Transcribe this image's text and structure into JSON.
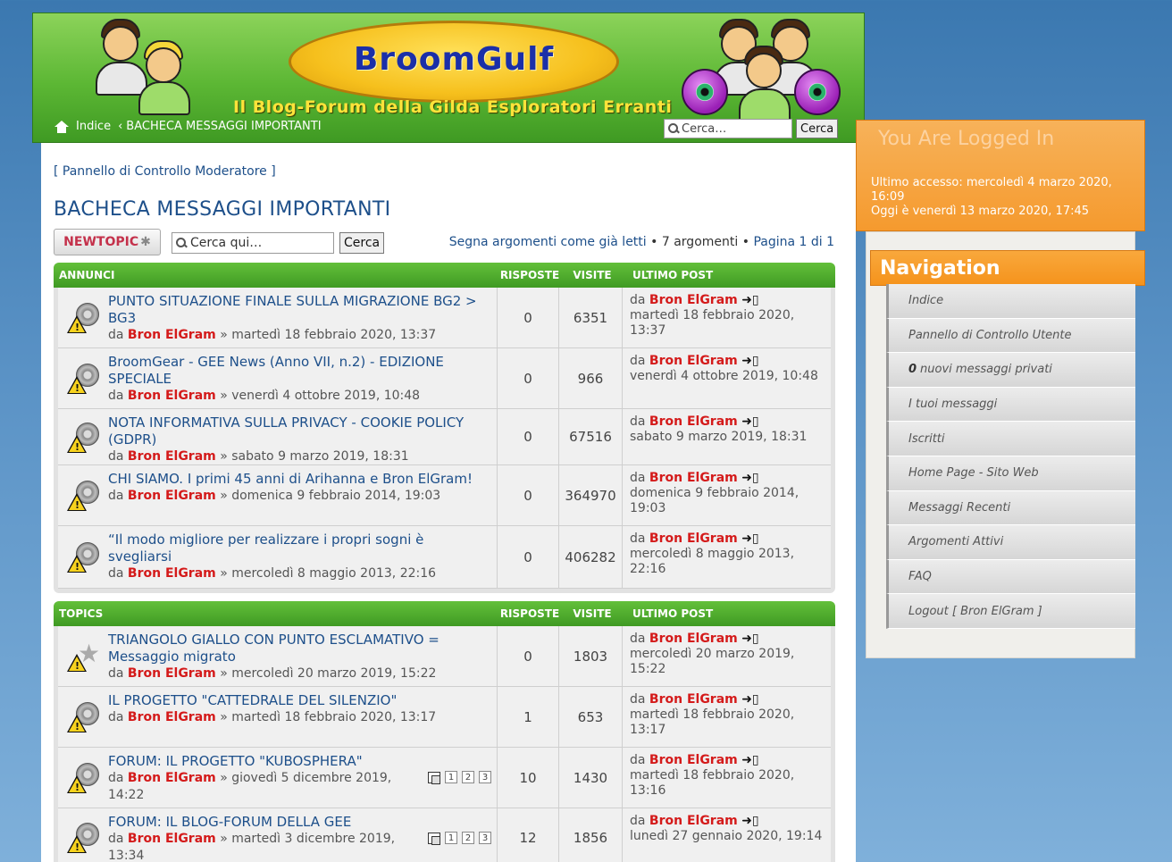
{
  "header": {
    "logo": "BroomGulf",
    "tagline": "Il Blog-Forum della Gilda Esploratori Erranti",
    "breadcrumb_home": "Indice",
    "breadcrumb_sep": "‹",
    "breadcrumb_current": "BACHECA MESSAGGI IMPORTANTI",
    "search_placeholder": "Cerca…",
    "search_button": "Cerca"
  },
  "main": {
    "mcp_link": "[ Pannello di Controllo Moderatore ]",
    "title": "BACHECA MESSAGGI IMPORTANTI",
    "newtopic_label": "NEWTOPIC",
    "search_placeholder": "Cerca qui…",
    "search_button": "Cerca",
    "mark_read": "Segna argomenti come già letti",
    "topic_count": "7 argomenti",
    "pagination": "Pagina 1 di 1"
  },
  "announcements": {
    "header": {
      "title": "ANNUNCI",
      "replies": "RISPOSTE",
      "views": "VISITE",
      "last": "ULTIMO POST"
    },
    "rows": [
      {
        "title": "PUNTO SITUAZIONE FINALE SULLA MIGRAZIONE BG2 > BG3",
        "by": "da",
        "author": "Bron ElGram",
        "date": "» martedì 18 febbraio 2020, 13:37",
        "replies": "0",
        "views": "6351",
        "last_by": "da",
        "last_author": "Bron ElGram",
        "last_date": "martedì 18 febbraio 2020, 13:37"
      },
      {
        "title": "BroomGear - GEE News (Anno VII, n.2) - EDIZIONE SPECIALE",
        "by": "da",
        "author": "Bron ElGram",
        "date": "» venerdì 4 ottobre 2019, 10:48",
        "replies": "0",
        "views": "966",
        "last_by": "da",
        "last_author": "Bron ElGram",
        "last_date": "venerdì 4 ottobre 2019, 10:48"
      },
      {
        "title": "NOTA INFORMATIVA SULLA PRIVACY - COOKIE POLICY (GDPR)",
        "by": "da",
        "author": "Bron ElGram",
        "date": "» sabato 9 marzo 2019, 18:31",
        "replies": "0",
        "views": "67516",
        "last_by": "da",
        "last_author": "Bron ElGram",
        "last_date": "sabato 9 marzo 2019, 18:31"
      },
      {
        "title": "CHI SIAMO. I primi 45 anni di Arihanna e Bron ElGram!",
        "by": "da",
        "author": "Bron ElGram",
        "date": "» domenica 9 febbraio 2014, 19:03",
        "replies": "0",
        "views": "364970",
        "last_by": "da",
        "last_author": "Bron ElGram",
        "last_date": "domenica 9 febbraio 2014, 19:03"
      },
      {
        "title": "“Il modo migliore per realizzare i propri sogni è svegliarsi",
        "by": "da",
        "author": "Bron ElGram",
        "date": "» mercoledì 8 maggio 2013, 22:16",
        "replies": "0",
        "views": "406282",
        "last_by": "da",
        "last_author": "Bron ElGram",
        "last_date": "mercoledì 8 maggio 2013, 22:16"
      }
    ]
  },
  "topics": {
    "header": {
      "title": "TOPICS",
      "replies": "RISPOSTE",
      "views": "VISITE",
      "last": "ULTIMO POST"
    },
    "rows": [
      {
        "title": "TRIANGOLO GIALLO CON PUNTO ESCLAMATIVO = Messaggio migrato",
        "by": "da",
        "author": "Bron ElGram",
        "date": "» mercoledì 20 marzo 2019, 15:22",
        "replies": "0",
        "views": "1803",
        "last_by": "da",
        "last_author": "Bron ElGram",
        "last_date": "mercoledì 20 marzo 2019, 15:22"
      },
      {
        "title": "IL PROGETTO \"CATTEDRALE DEL SILENZIO\"",
        "by": "da",
        "author": "Bron ElGram",
        "date": "» martedì 18 febbraio 2020, 13:17",
        "replies": "1",
        "views": "653",
        "last_by": "da",
        "last_author": "Bron ElGram",
        "last_date": "martedì 18 febbraio 2020, 13:17"
      },
      {
        "title": "FORUM: IL PROGETTO \"KUBOSPHERA\"",
        "by": "da",
        "author": "Bron ElGram",
        "date": "» giovedì 5 dicembre 2019, 14:22",
        "replies": "10",
        "views": "1430",
        "last_by": "da",
        "last_author": "Bron ElGram",
        "last_date": "martedì 18 febbraio 2020, 13:16",
        "pages": [
          "1",
          "2",
          "3"
        ]
      },
      {
        "title": "FORUM: IL BLOG-FORUM DELLA GEE",
        "by": "da",
        "author": "Bron ElGram",
        "date": "» martedì 3 dicembre 2019, 13:34",
        "replies": "12",
        "views": "1856",
        "last_by": "da",
        "last_author": "Bron ElGram",
        "last_date": "lunedì 27 gennaio 2020, 19:14",
        "pages": [
          "1",
          "2",
          "3"
        ]
      }
    ]
  },
  "sidebar": {
    "logged_title": "You Are Logged In",
    "last_visit": "Ultimo accesso: mercoledì 4 marzo 2020, 16:09",
    "today": "Oggi è venerdì 13 marzo 2020, 17:45",
    "nav_title": "Navigation",
    "items": [
      {
        "label": "Indice"
      },
      {
        "label": "Pannello di Controllo Utente"
      },
      {
        "count": "0",
        "label": "nuovi messaggi privati"
      },
      {
        "label": "I tuoi messaggi"
      },
      {
        "label": "Iscritti"
      },
      {
        "label": "Home Page - Sito Web"
      },
      {
        "label": "Messaggi Recenti"
      },
      {
        "label": "Argomenti Attivi"
      },
      {
        "label": "FAQ"
      },
      {
        "label": "Logout [ Bron ElGram ]"
      }
    ]
  },
  "colors": {
    "header_green": "#5cb734",
    "link_blue": "#1d4f8a",
    "author_red": "#d41a1a",
    "sidebar_orange": "#f5931c"
  }
}
